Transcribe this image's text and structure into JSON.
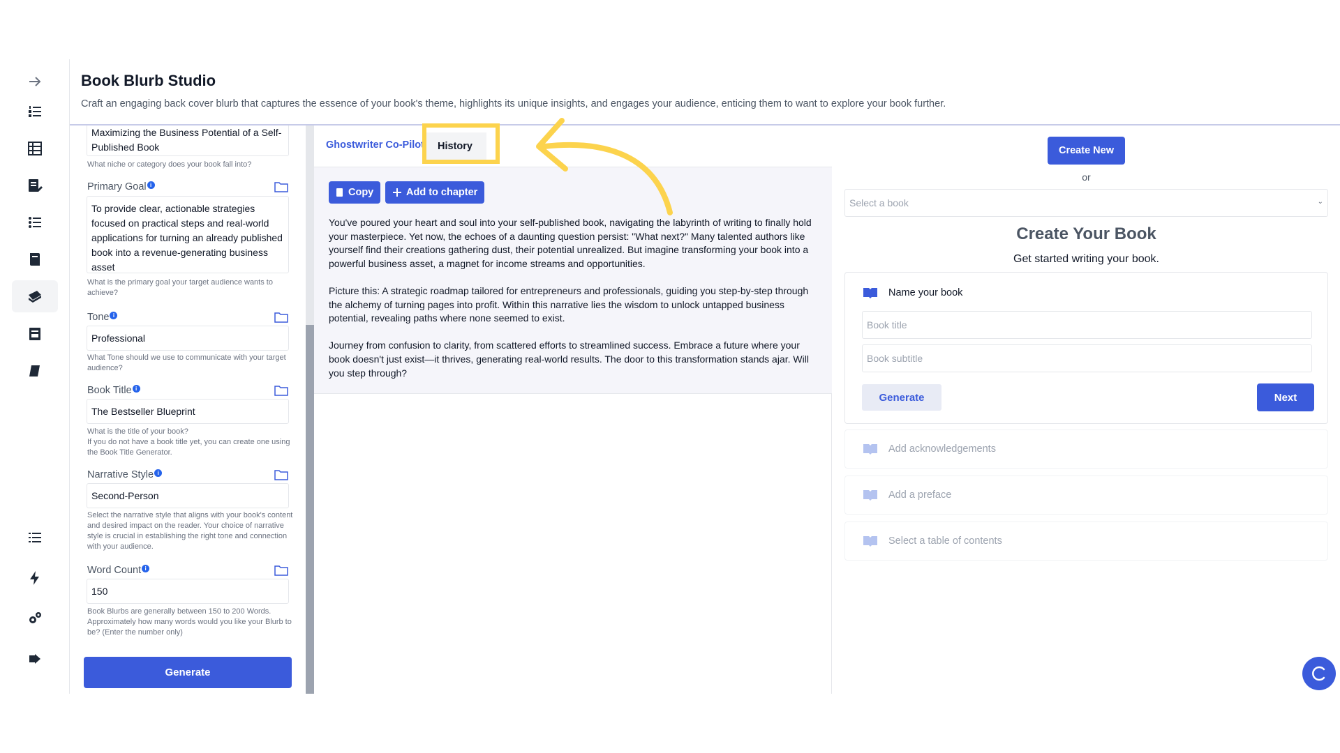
{
  "header": {
    "title": "Book Blurb Studio",
    "subtitle": "Craft an engaging back cover blurb that captures the essence of your book's theme, highlights its unique insights, and engages your audience, enticing them to want to explore your book further."
  },
  "sidebar": {
    "icons": [
      "arrow-right-icon",
      "numbered-list-icon",
      "table-icon",
      "edit-document-icon",
      "checklist-icon",
      "book-stack-icon",
      "books-icon",
      "archive-icon",
      "book-icon",
      "list-icon",
      "lightning-icon",
      "settings-icon",
      "logout-icon"
    ]
  },
  "form": {
    "niche_value": "Maximizing the Business Potential of a Self-Published Book",
    "niche_help": "What niche or category does your book fall into?",
    "goal_label": "Primary Goal",
    "goal_value": "To provide clear, actionable strategies focused on practical steps and real-world applications for turning an already published book into a revenue-generating business asset",
    "goal_help": "What is the primary goal your target audience wants to achieve?",
    "tone_label": "Tone",
    "tone_value": "Professional",
    "tone_help": "What Tone should we use to communicate with your target audience?",
    "title_label": "Book Title",
    "title_value": "The Bestseller Blueprint",
    "title_help_1": "What is the title of your book?",
    "title_help_2": "If you do not have a book title yet, you can create one using the Book Title Generator.",
    "narrative_label": "Narrative Style",
    "narrative_value": "Second-Person",
    "narrative_help": "Select the narrative style that aligns with your book's content and desired impact on the reader. Your choice of narrative style is crucial in establishing the right tone and connection with your audience.",
    "wordcount_label": "Word Count",
    "wordcount_value": "150",
    "wordcount_help": "Book Blurbs are generally between 150 to 200 Words. Approximately how many words would you like your Blurb to be? (Enter the number only)",
    "generate_label": "Generate",
    "info_mark": "i"
  },
  "middle": {
    "tab_copilot": "Ghostwriter Co-Pilot",
    "tab_history": "History",
    "copy_label": "Copy",
    "add_chapter_label": "Add to chapter",
    "blurb": [
      "You've poured your heart and soul into your self-published book, navigating the labyrinth of writing to finally hold your masterpiece. Yet now, the echoes of a daunting question persist: \"What next?\" Many talented authors like yourself find their creations gathering dust, their potential unrealized. But imagine transforming your book into a powerful business asset, a magnet for income streams and opportunities.",
      "Picture this: A strategic roadmap tailored for entrepreneurs and professionals, guiding you step-by-step through the alchemy of turning pages into profit. Within this narrative lies the wisdom to unlock untapped business potential, revealing paths where none seemed to exist.",
      "Journey from confusion to clarity, from scattered efforts to streamlined success. Embrace a future where your book doesn't just exist—it thrives, generating real-world results. The door to this transformation stands ajar. Will you step through?"
    ]
  },
  "right": {
    "create_new": "Create New",
    "or": "or",
    "select_placeholder": "Select a book",
    "heading": "Create Your Book",
    "subheading": "Get started writing your book.",
    "name_book": "Name your book",
    "title_placeholder": "Book title",
    "subtitle_placeholder": "Book subtitle",
    "generate_label": "Generate",
    "next_label": "Next",
    "steps": [
      "Add acknowledgements",
      "Add a preface",
      "Select a table of contents"
    ]
  },
  "colors": {
    "accent": "#3b5bdb",
    "highlight": "#fcd34d"
  }
}
